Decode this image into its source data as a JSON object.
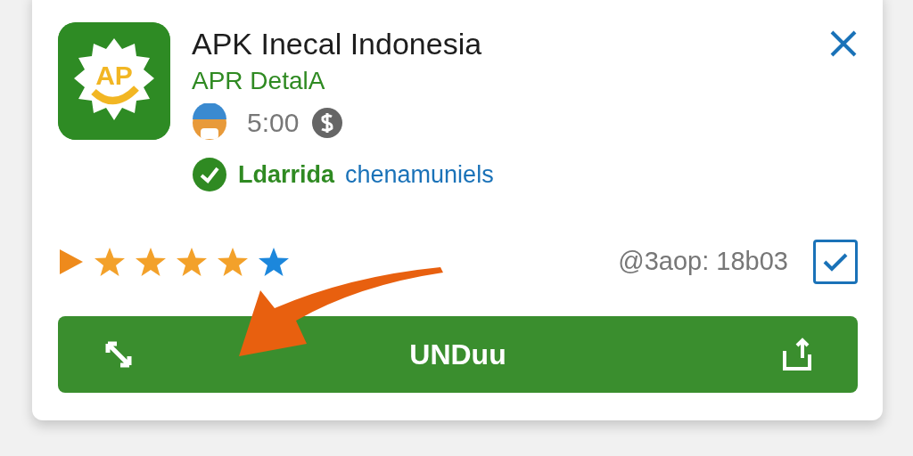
{
  "app": {
    "icon_text": "AP",
    "title": "APK Inecal Indonesia",
    "subtitle": "APR DetalA",
    "time": "5:00",
    "verified": true,
    "developer": "Ldarrida",
    "developer_note": "chenamuniels"
  },
  "rating": {
    "stars": 4
  },
  "code": "@3aop: 18b03",
  "checkbox": {
    "checked": true
  },
  "download_button": {
    "label": "UNDuu"
  }
}
